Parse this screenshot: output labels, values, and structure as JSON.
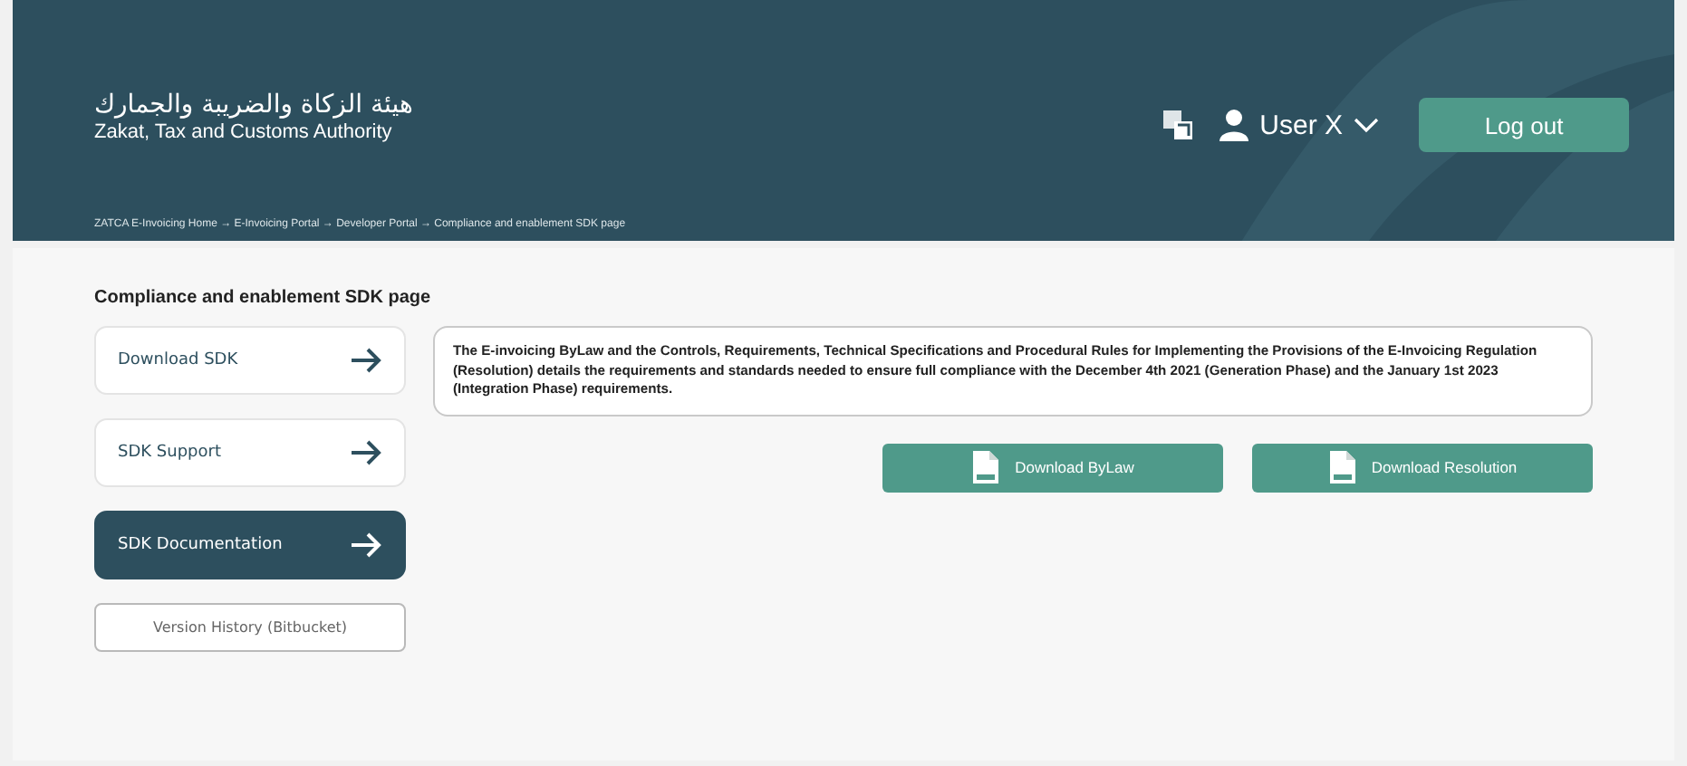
{
  "header": {
    "logo_arabic": "هيئة الزكاة والضريبة والجمارك",
    "logo_english": "Zakat, Tax and Customs Authority",
    "user": "User X",
    "logout": "Log out",
    "breadcrumb": "ZATCA E-Invoicing Home → E-Invoicing Portal → Developer Portal → Compliance and enablement SDK page"
  },
  "page_title": "Compliance and enablement SDK page",
  "sidebar": {
    "items": [
      {
        "label": "Download SDK",
        "selected": false
      },
      {
        "label": "SDK Support",
        "selected": false
      },
      {
        "label": "SDK Documentation",
        "selected": true
      }
    ],
    "version_history": "Version History (Bitbucket)"
  },
  "description": "The E-invoicing ByLaw and the Controls, Requirements, Technical Specifications and Procedural Rules for Implementing the Provisions of the E-Invoicing Regulation (Resolution) details the requirements and standards needed to ensure full compliance with the December 4th 2021 (Generation Phase) and the January 1st 2023 (Integration Phase) requirements.",
  "downloads": [
    "Download ByLaw",
    "Download Resolution"
  ]
}
